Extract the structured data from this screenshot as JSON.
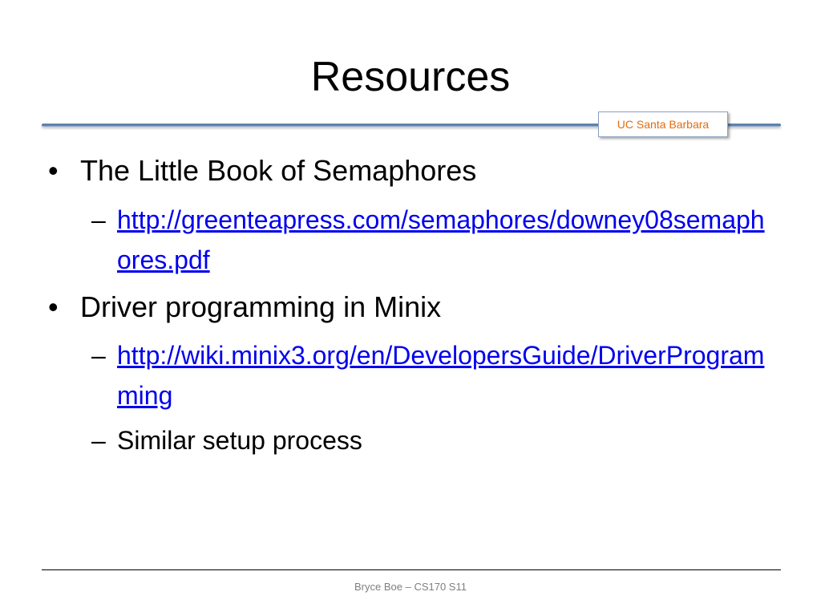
{
  "slide": {
    "title": "Resources",
    "badge": "UC Santa Barbara",
    "bullets": [
      {
        "text": "The Little Book of Semaphores",
        "subitems": [
          {
            "text": "http://greenteapress.com/semaphores/downey08semaphores.pdf",
            "is_link": true
          }
        ]
      },
      {
        "text": "Driver programming in Minix",
        "subitems": [
          {
            "text": "http://wiki.minix3.org/en/DevelopersGuide/DriverProgramming",
            "is_link": true
          },
          {
            "text": "Similar setup process",
            "is_link": false
          }
        ]
      }
    ],
    "bullet_glyph": "•",
    "dash_glyph": "–",
    "footer": "Bryce Boe – CS170 S11"
  },
  "colors": {
    "link": "#0000ee",
    "badge_text": "#e46c0a",
    "rule": "#4f74a6",
    "footer_text": "#7f7f7f"
  }
}
